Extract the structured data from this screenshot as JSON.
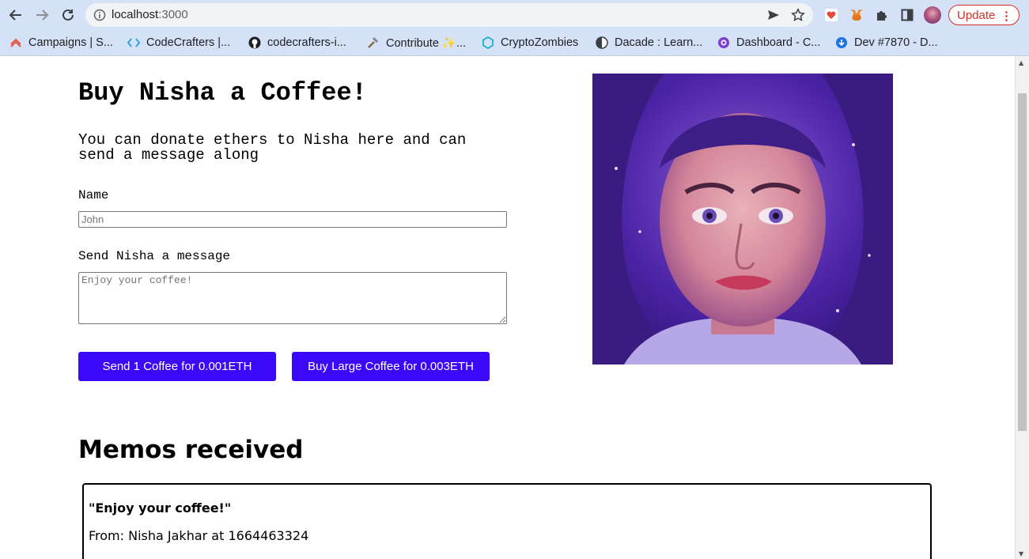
{
  "browser": {
    "url_host": "localhost",
    "url_port": ":3000",
    "update_label": "Update",
    "bookmarks": [
      {
        "label": "Campaigns | S...",
        "icon": "campaigns-icon"
      },
      {
        "label": "CodeCrafters |...",
        "icon": "code-icon"
      },
      {
        "label": "codecrafters-i...",
        "icon": "github-icon"
      },
      {
        "label": "Contribute ✨...",
        "icon": "hammer-icon"
      },
      {
        "label": "CryptoZombies",
        "icon": "cryptozombies-icon"
      },
      {
        "label": "Dacade : Learn...",
        "icon": "dacade-icon"
      },
      {
        "label": "Dashboard - C...",
        "icon": "dashboard-icon"
      },
      {
        "label": "Dev #7870 - D...",
        "icon": "dev-icon"
      }
    ],
    "more_bookmarks": "»"
  },
  "page": {
    "title": "Buy Nisha a Coffee!",
    "subtitle": "You can donate ethers to Nisha here and can send a message along",
    "name_label": "Name",
    "name_placeholder": "John",
    "message_label": "Send Nisha a message",
    "message_placeholder": "Enjoy your coffee!",
    "buttons": {
      "small": "Send 1 Coffee for 0.001ETH",
      "large": "Buy Large Coffee for 0.003ETH"
    },
    "memos_title": "Memos received",
    "memos": [
      {
        "message": "\"Enjoy your coffee!\"",
        "from": "From: Nisha Jakhar at 1664463324"
      }
    ]
  },
  "colors": {
    "button": "#3b08f9",
    "chrome": "#d4e1f7",
    "update": "#d93025"
  }
}
